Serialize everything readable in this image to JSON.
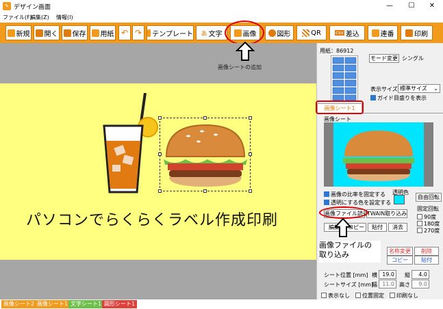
{
  "window": {
    "title": "デザイン画面"
  },
  "menu": [
    "ファイル(F)",
    "編集(Z)",
    "情報(I)"
  ],
  "toolbar": {
    "new": "新規",
    "open": "開く",
    "save": "保存",
    "paper": "用紙",
    "template": "テンプレート",
    "text": "文字",
    "image": "画像",
    "shape": "図形",
    "qr": "QR",
    "csv_badge": "csv",
    "merge": "差込",
    "serial": "連番",
    "print": "印刷"
  },
  "canvas": {
    "hint": "画像シートの追加",
    "catchphrase": "パソコンでらくらくラベル作成印刷"
  },
  "right_panel": {
    "paper_label": "用紙：86912",
    "mode_button": "モード変更",
    "mode_value": "シングル",
    "display_size_label": "表示サイズ",
    "display_size_value": "標準サイズ",
    "guide_label": "ガイド目盛りを表示",
    "sheet_tab": "画像シート1",
    "image_sheet_label": "画像シート",
    "fix_ratio_label": "画像の比率を固定する",
    "transparent_label": "透明にする色を設定する",
    "transparent_color_label": "透明色",
    "free_rotate": "自由回転",
    "load_file": "画像ファイル読込",
    "twain": "TWAIN取り込み",
    "fixed_rotate_label": "固定回転",
    "rot90": "90度",
    "rot180": "180度",
    "rot270": "270度",
    "edit": "編集",
    "copy": "コピー",
    "paste": "貼付",
    "erase": "消去",
    "rename": "名称変更",
    "delete": "削除",
    "copy2": "コピー",
    "paste2": "貼付",
    "sheet_pos_label": "シート位置 [mm]",
    "width_short": "横",
    "pos_x": "19.0",
    "height_short": "縦",
    "pos_y": "4.0",
    "sheet_size_label": "シートサイズ [mm]",
    "w_label": "幅",
    "size_w": "11.0",
    "h_label": "高さ",
    "size_h": "9.0",
    "hide_label": "表示なし",
    "lock_label": "位置固定",
    "noprint_label": "印刷なし",
    "accent_color": "#f29a1c"
  },
  "callout": {
    "line1": "画像ファイルの",
    "line2": "取り込み"
  },
  "statusbar": {
    "tabs": [
      "画像シート2",
      "画像シート1",
      "文字シート1",
      "図形シート1"
    ],
    "colors": [
      "#f29a1c",
      "#f29a1c",
      "#6cc04a",
      "#e0403a"
    ]
  }
}
